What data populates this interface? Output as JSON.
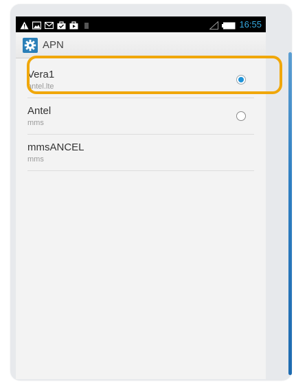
{
  "status_bar": {
    "time": "16:55",
    "icons": [
      "warning-icon",
      "image-icon",
      "mail-icon",
      "bag-check-icon",
      "play-store-icon",
      "sim-icon",
      "signal-icon",
      "battery-icon"
    ]
  },
  "action_bar": {
    "title": "APN",
    "icon": "settings-icon"
  },
  "apn_list": [
    {
      "name": "Vera1",
      "type": "antel.lte",
      "selected": true
    },
    {
      "name": "Antel",
      "type": "mms",
      "selected": false
    },
    {
      "name": "mmsANCEL",
      "type": "mms",
      "selected": null
    }
  ],
  "colors": {
    "highlight": "#f0a70a",
    "status_time": "#35a9e0",
    "radio_selected": "#1f93d8",
    "app_icon_bg": "#2a7fb8"
  }
}
